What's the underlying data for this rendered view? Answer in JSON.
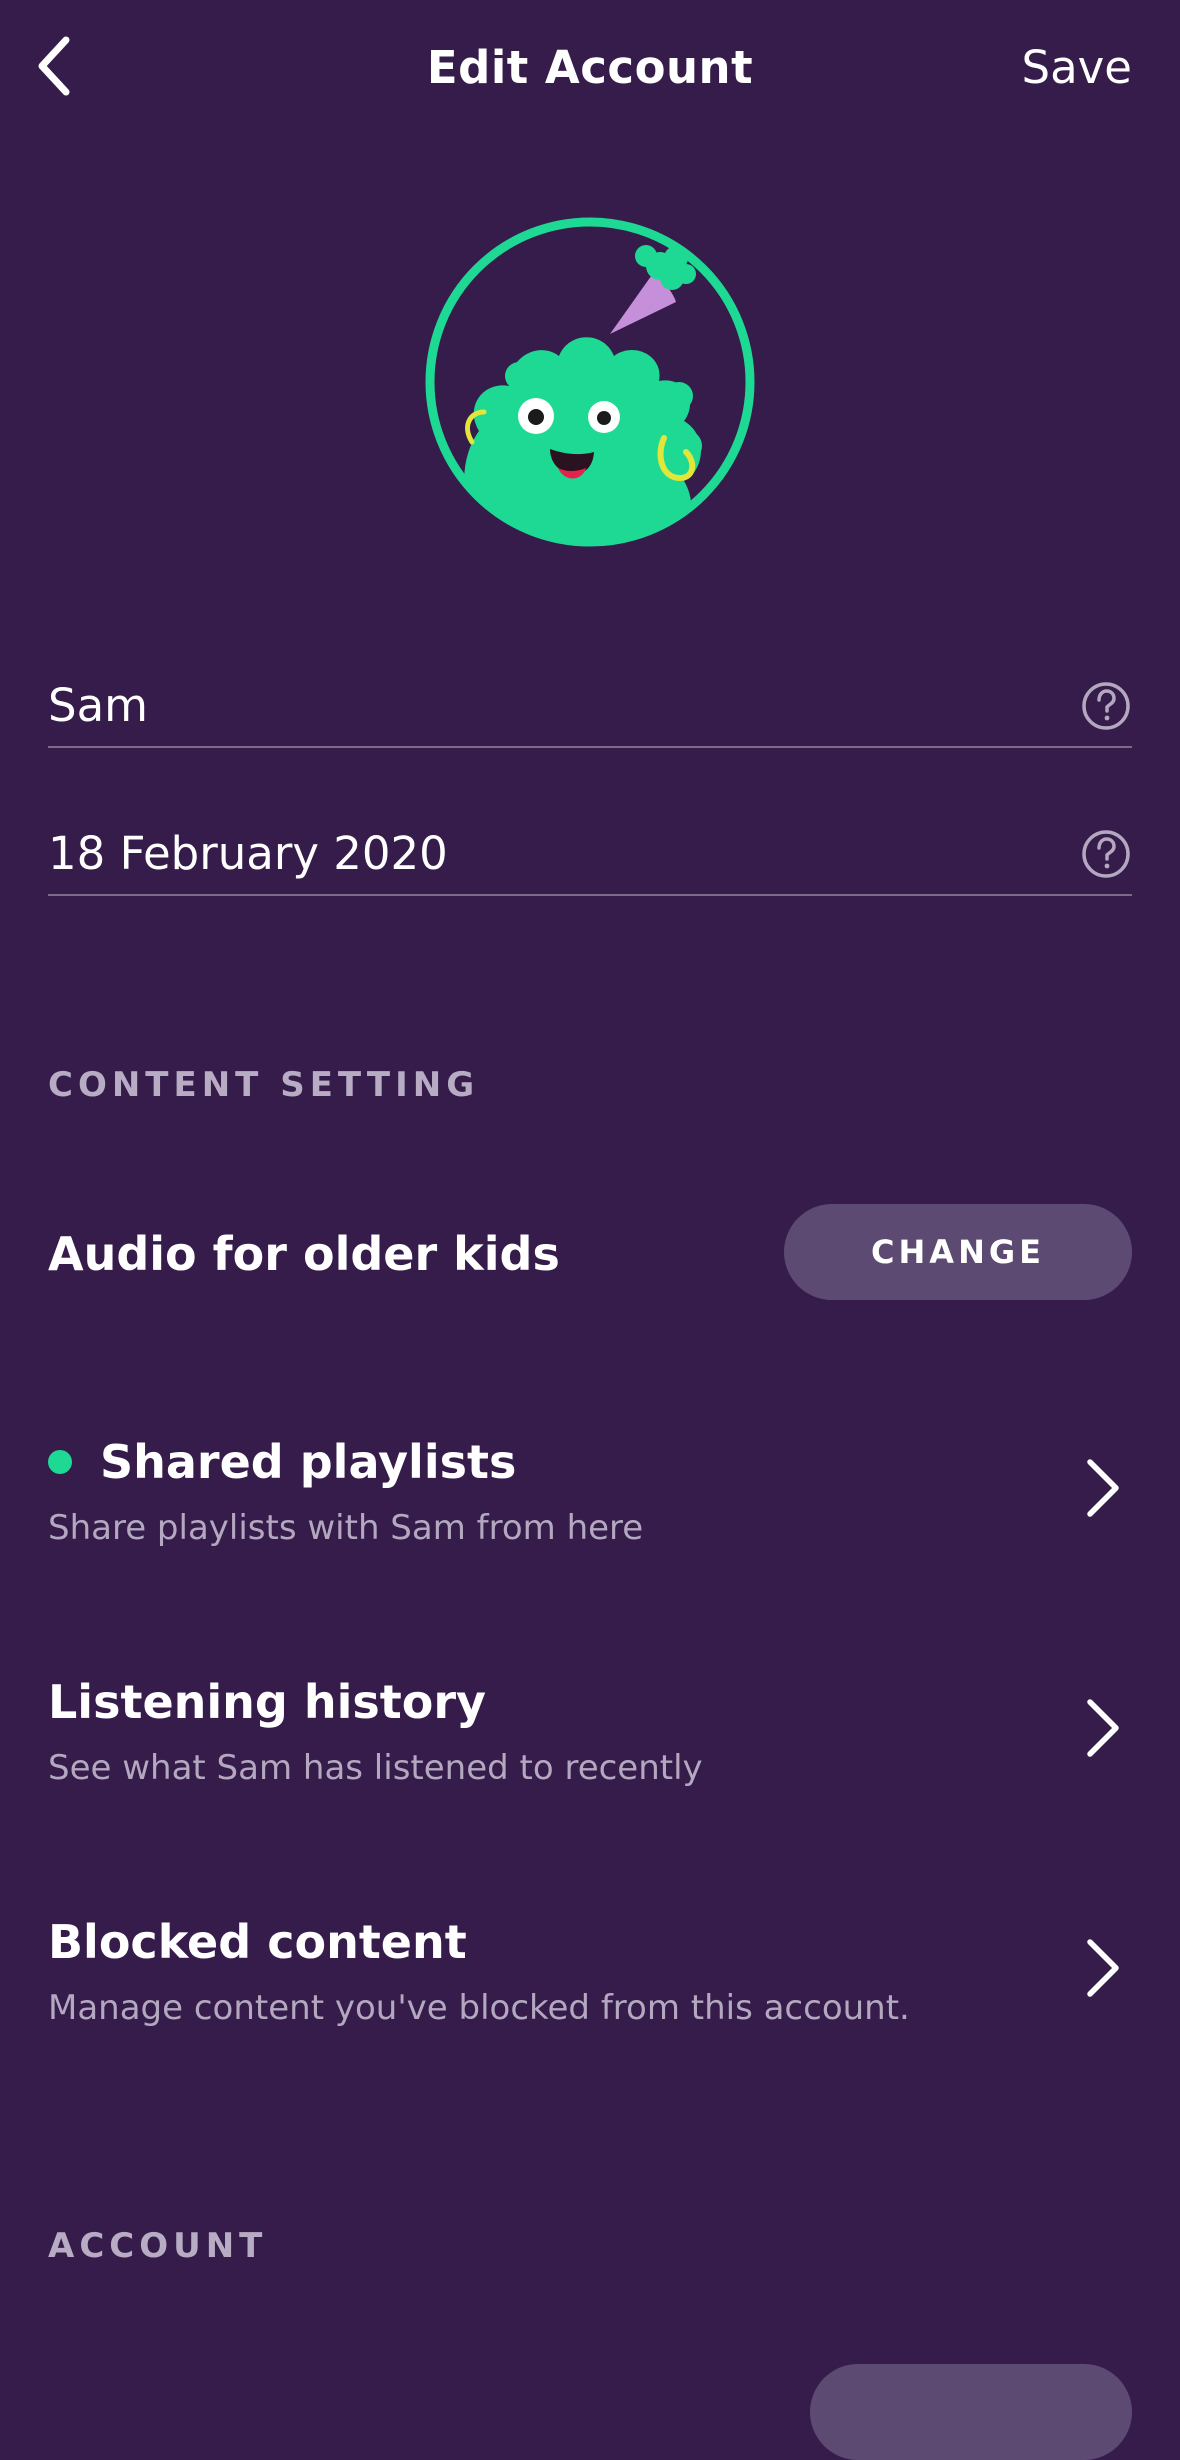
{
  "header": {
    "title": "Edit Account",
    "save_label": "Save",
    "back_icon": "chevron-left-icon"
  },
  "avatar": {
    "description_icon": "green-monster-avatar",
    "ring_color": "#1ed994"
  },
  "fields": {
    "name": "Sam",
    "birthdate": "18 February 2020"
  },
  "content_setting": {
    "section_label": "CONTENT SETTING",
    "level_label": "Audio for older kids",
    "change_label": "CHANGE"
  },
  "rows": [
    {
      "title": "Shared playlists",
      "subtitle": "Share playlists with Sam from here",
      "has_dot": true
    },
    {
      "title": "Listening history",
      "subtitle": "See what Sam has listened to recently",
      "has_dot": false
    },
    {
      "title": "Blocked content",
      "subtitle": "Manage content you've blocked from this account.",
      "has_dot": false
    }
  ],
  "account": {
    "section_label": "ACCOUNT"
  },
  "colors": {
    "background": "#351c4a",
    "accent_green": "#1ed994",
    "button_bg": "#5d4a73",
    "muted_text": "#b3a8bf"
  }
}
